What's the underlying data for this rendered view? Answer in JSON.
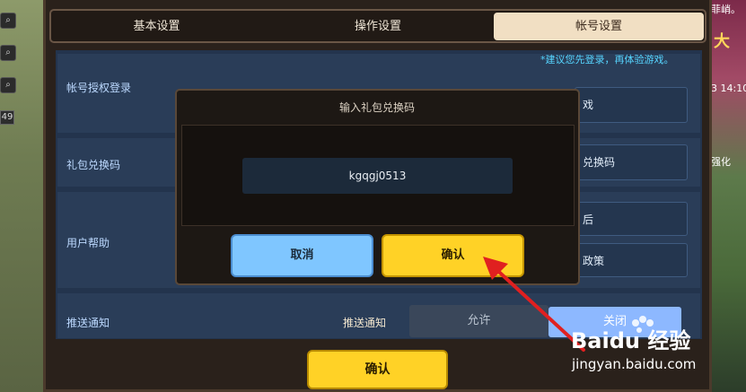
{
  "tabs": [
    {
      "label": "基本设置",
      "active": false
    },
    {
      "label": "操作设置",
      "active": false
    },
    {
      "label": "帐号设置",
      "active": true
    }
  ],
  "left_strip": {
    "level_badge": "49"
  },
  "right_strip": {
    "text_top": "菲峭。",
    "big_char": "大",
    "time": "3 14:10",
    "badge": "强化"
  },
  "account_section": {
    "hint": "*建议您先登录，再体验游戏。",
    "rows": [
      {
        "label": "帐号授权登录",
        "button": "戏"
      },
      {
        "label": "礼包兑换码",
        "button": "兑换码"
      },
      {
        "label": "用户帮助",
        "buttons": [
          "后",
          "政策"
        ]
      }
    ]
  },
  "push": {
    "label": "推送通知",
    "sub_label": "推送通知",
    "allow": "允许",
    "close": "关闭"
  },
  "confirm_button": "确认",
  "modal": {
    "title": "输入礼包兑换码",
    "code_value": "kgqgj0513",
    "cancel": "取消",
    "ok": "确认"
  },
  "watermark": {
    "brand": "Baidu 经验",
    "url": "jingyan.baidu.com"
  },
  "colors": {
    "accent_yellow": "#ffd226",
    "accent_blue": "#7fc6ff",
    "hint_cyan": "#56d5ff",
    "panel_blue": "#23344d",
    "arrow_red": "#e02020"
  }
}
